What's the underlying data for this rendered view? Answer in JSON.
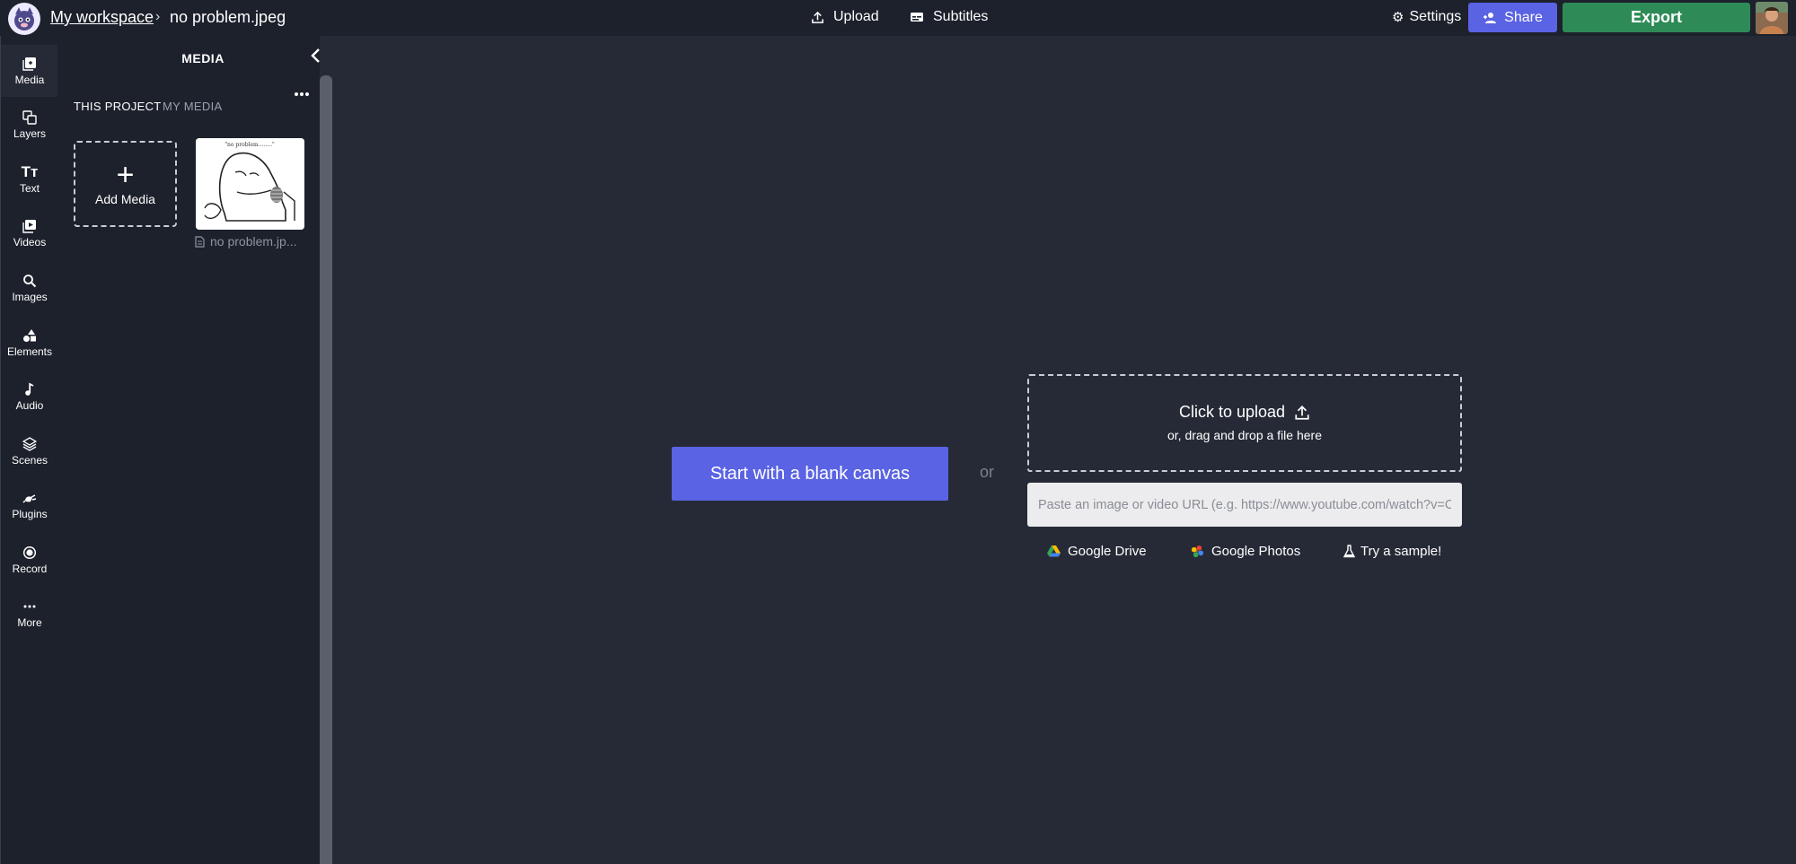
{
  "header": {
    "workspace_label": "My workspace",
    "separator": "›",
    "file_name": "no problem.jpeg",
    "upload_label": "Upload",
    "subtitles_label": "Subtitles",
    "settings_label": "Settings",
    "share_label": "Share",
    "export_label": "Export"
  },
  "sidebar": {
    "items": [
      {
        "label": "Media",
        "icon": "media-icon"
      },
      {
        "label": "Layers",
        "icon": "layers-icon"
      },
      {
        "label": "Text",
        "icon": "text-icon"
      },
      {
        "label": "Videos",
        "icon": "videos-icon"
      },
      {
        "label": "Images",
        "icon": "search-icon"
      },
      {
        "label": "Elements",
        "icon": "elements-icon"
      },
      {
        "label": "Audio",
        "icon": "music-note-icon"
      },
      {
        "label": "Scenes",
        "icon": "scenes-icon"
      },
      {
        "label": "Plugins",
        "icon": "plug-icon"
      },
      {
        "label": "Record",
        "icon": "record-icon"
      },
      {
        "label": "More",
        "icon": "more-icon"
      }
    ],
    "active": "Media"
  },
  "media_panel": {
    "title": "MEDIA",
    "tabs": [
      {
        "label": "THIS PROJECT",
        "active": true
      },
      {
        "label": "MY MEDIA",
        "active": false
      }
    ],
    "add_media_label": "Add Media",
    "items": [
      {
        "name": "no problem.jp...",
        "caption": "\"no problem........\""
      }
    ]
  },
  "canvas": {
    "blank_canvas_label": "Start with a blank canvas",
    "or_label": "or",
    "upload_title": "Click to upload",
    "upload_subtitle": "or, drag and drop a file here",
    "url_placeholder": "Paste an image or video URL (e.g. https://www.youtube.com/watch?v=C",
    "url_value": "",
    "sources": {
      "google_drive": "Google Drive",
      "google_photos": "Google Photos",
      "sample": "Try a sample!"
    }
  },
  "colors": {
    "topbar_bg": "#1d212c",
    "canvas_bg": "#262a36",
    "accent": "#5a63e3",
    "export": "#2e8b57"
  }
}
